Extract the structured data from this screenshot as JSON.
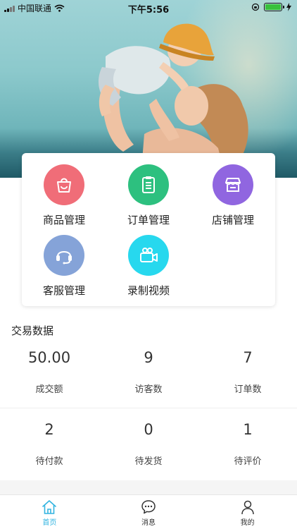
{
  "status_bar": {
    "carrier": "中国联通",
    "time": "下午5:56"
  },
  "menu": {
    "items": [
      {
        "label": "商品管理",
        "icon": "shopping-bag-icon",
        "color": "#f06d78"
      },
      {
        "label": "订单管理",
        "icon": "clipboard-icon",
        "color": "#2dc07f"
      },
      {
        "label": "店铺管理",
        "icon": "store-icon",
        "color": "#9066e0"
      },
      {
        "label": "客服管理",
        "icon": "headset-icon",
        "color": "#85a3d8"
      },
      {
        "label": "录制视频",
        "icon": "video-camera-icon",
        "color": "#27d8ee"
      }
    ]
  },
  "trade": {
    "title": "交易数据",
    "stats": [
      {
        "value": "50.00",
        "label": "成交额"
      },
      {
        "value": "9",
        "label": "访客数"
      },
      {
        "value": "7",
        "label": "订单数"
      },
      {
        "value": "2",
        "label": "待付款"
      },
      {
        "value": "0",
        "label": "待发货"
      },
      {
        "value": "1",
        "label": "待评价"
      }
    ]
  },
  "tabbar": {
    "active_color": "#32b4e0",
    "tabs": [
      {
        "label": "首页",
        "icon": "home-icon",
        "active": true
      },
      {
        "label": "消息",
        "icon": "message-icon",
        "active": false
      },
      {
        "label": "我的",
        "icon": "user-icon",
        "active": false
      }
    ]
  }
}
